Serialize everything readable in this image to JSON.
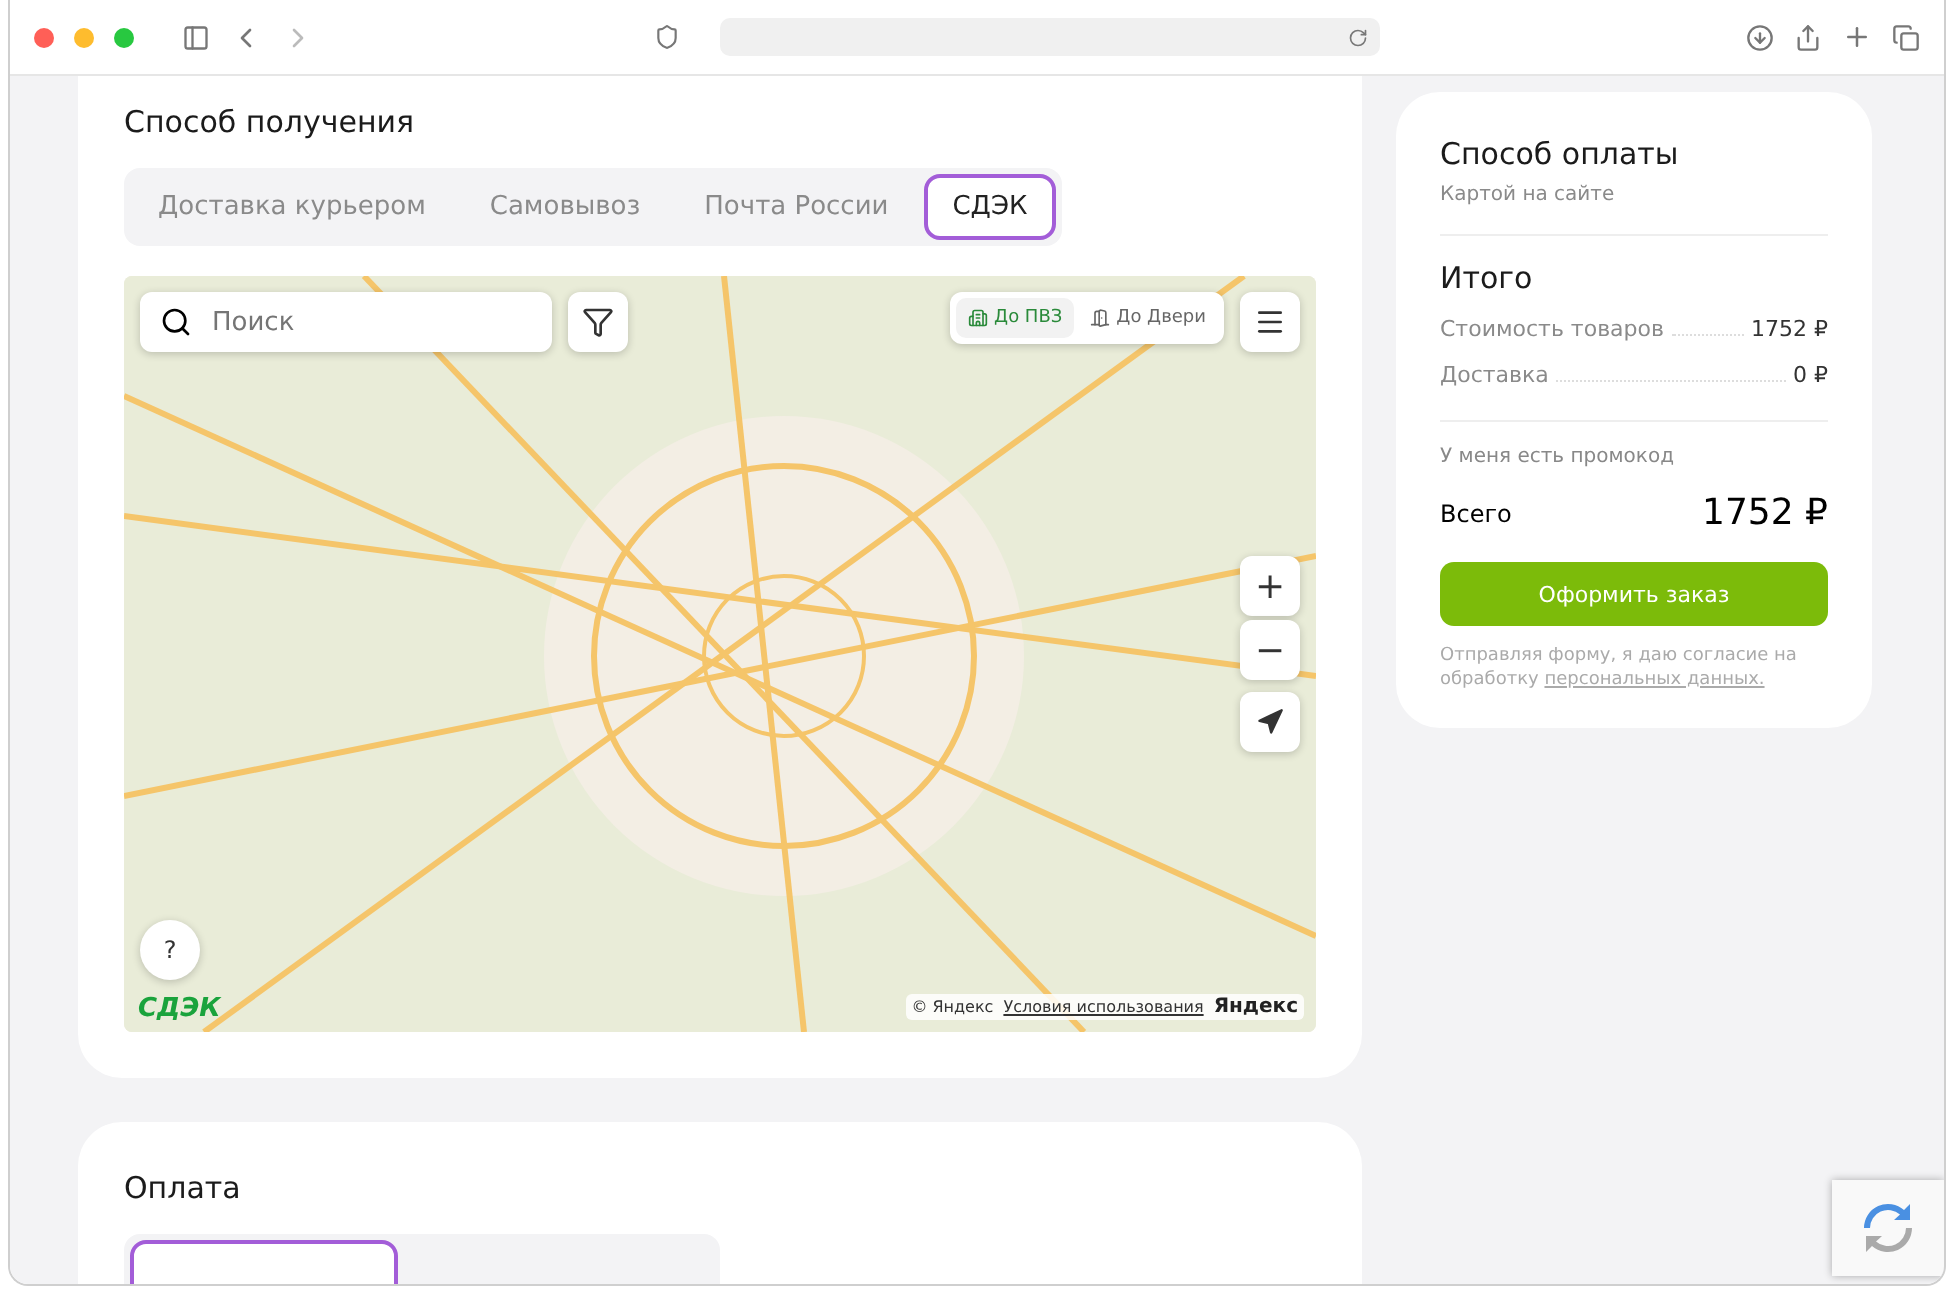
{
  "delivery": {
    "title": "Способ получения",
    "tabs": [
      {
        "label": "Доставка курьером",
        "selected": false
      },
      {
        "label": "Самовывоз",
        "selected": false
      },
      {
        "label": "Почта России",
        "selected": false
      },
      {
        "label": "СДЭК",
        "selected": true
      }
    ],
    "map": {
      "search_placeholder": "Поиск",
      "modes": [
        {
          "label": "До ПВЗ",
          "selected": true
        },
        {
          "label": "До Двери",
          "selected": false
        }
      ],
      "zoom_in": "+",
      "zoom_out": "−",
      "help": "?",
      "logo": "СДЭК",
      "copyright": "© Яндекс",
      "terms": "Условия использования",
      "provider": "Яндекс"
    }
  },
  "summary": {
    "payment_title": "Способ оплаты",
    "payment_method": "Картой на сайте",
    "total_title": "Итого",
    "lines": [
      {
        "label": "Стоимость товаров",
        "value": "1752 ₽"
      },
      {
        "label": "Доставка",
        "value": "0 ₽"
      }
    ],
    "promo": "У меня есть промокод",
    "total_label": "Всего",
    "total_value": "1752 ₽",
    "submit": "Оформить заказ",
    "consent": "Отправляя форму, я даю согласие на обработку",
    "consent_link": "персональных данных."
  },
  "payment": {
    "title": "Оплата",
    "tabs": [
      {
        "selected": true
      }
    ]
  }
}
